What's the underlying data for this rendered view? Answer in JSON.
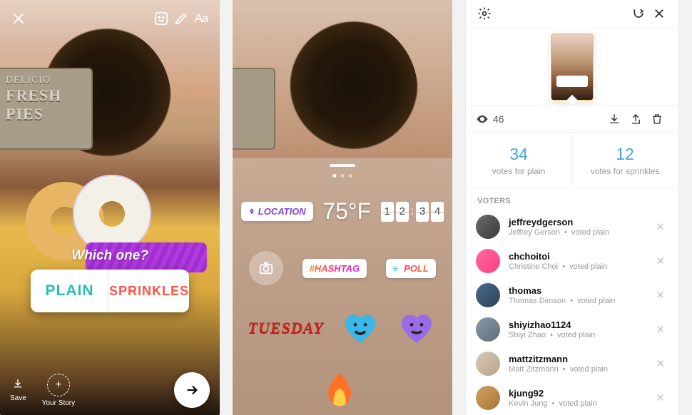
{
  "screen1": {
    "sign_line1": "DELICIO",
    "sign_line2": "FRESH PIES",
    "text_tool": "Aa",
    "poll": {
      "question": "Which one?",
      "option_a": "PLAIN",
      "option_b": "SPRINKLES"
    },
    "save_label": "Save",
    "your_story_label": "Your Story"
  },
  "screen2": {
    "stickers": {
      "location": "LOCATION",
      "temperature": "75°F",
      "clock": [
        "1",
        "2",
        "3",
        "4"
      ],
      "hashtag": "#HASHTAG",
      "poll": "POLL",
      "day": "TUESDAY"
    }
  },
  "screen3": {
    "view_count": "46",
    "votes": {
      "a_count": "34",
      "a_label": "votes for plain",
      "b_count": "12",
      "b_label": "votes for sprinkles"
    },
    "section": "VOTERS",
    "voters": [
      {
        "user": "jeffreydgerson",
        "name": "Jeffrey Gerson",
        "vote": "voted plain"
      },
      {
        "user": "chchoitoi",
        "name": "Christine Choi",
        "vote": "voted plain"
      },
      {
        "user": "thomas",
        "name": "Thomas Dimson",
        "vote": "voted plain"
      },
      {
        "user": "shiyizhao1124",
        "name": "Shiyi Zhao",
        "vote": "voted plain"
      },
      {
        "user": "mattzitzmann",
        "name": "Matt Zitzmann",
        "vote": "voted plain"
      },
      {
        "user": "kjung92",
        "name": "Kevin Jung",
        "vote": "voted plain"
      }
    ]
  }
}
